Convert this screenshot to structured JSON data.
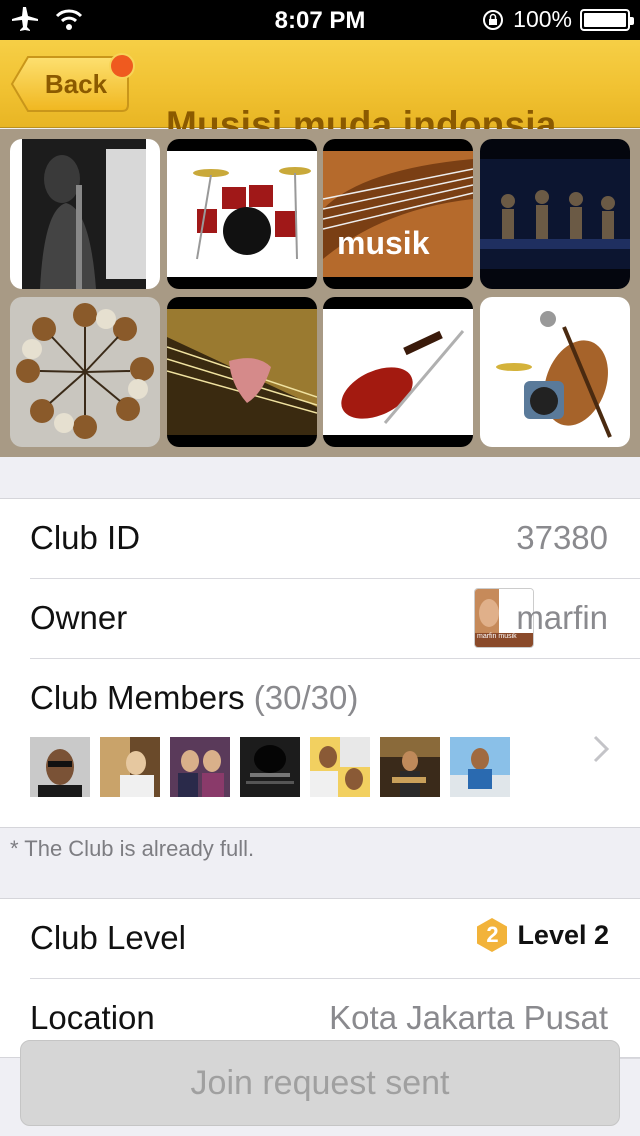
{
  "status_bar": {
    "time": "8:07 PM",
    "battery": "100%",
    "icons": [
      "airplane-icon",
      "wifi-icon",
      "rotation-lock-icon",
      "battery-icon"
    ]
  },
  "nav": {
    "back_label": "Back",
    "title": "Musisi muda indonsia",
    "accent_color": "#f1c232",
    "badge_color": "#ef5a1f"
  },
  "gallery": {
    "photos": [
      "singer-studio-photo",
      "drum-kit-photo",
      "guitar-strings-musik-photo",
      "live-band-photo",
      "guitar-circle-photo",
      "guitar-pick-photo",
      "violin-photo",
      "instruments-collage-photo"
    ],
    "thumb_caption": "musik"
  },
  "info": {
    "club_id_label": "Club ID",
    "club_id_value": "37380",
    "owner_label": "Owner",
    "owner_name": "marfin",
    "owner_thumb_caption": "marfin musik",
    "members_label": "Club Members",
    "members_count": "(30/30)",
    "member_avatars": [
      "member-1",
      "member-2",
      "member-3",
      "member-4",
      "member-5",
      "member-6",
      "member-7"
    ],
    "full_note": "* The Club is already full."
  },
  "details": {
    "level_label": "Club Level",
    "level_number": "2",
    "level_value": "Level 2",
    "location_label": "Location",
    "location_value": "Kota Jakarta Pusat"
  },
  "join_button": {
    "label": "Join request sent"
  }
}
